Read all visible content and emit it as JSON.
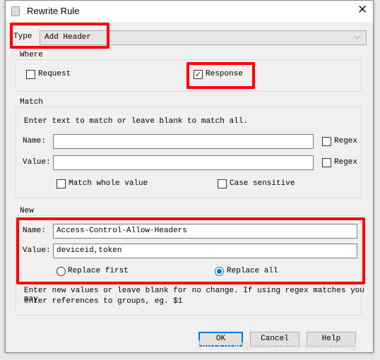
{
  "window": {
    "title": "Rewrite Rule",
    "close_icon": "close-icon"
  },
  "type": {
    "label": "Type",
    "value": "Add Header"
  },
  "where": {
    "legend": "Where",
    "request": {
      "label": "Request",
      "checked": false
    },
    "response": {
      "label": "Response",
      "checked": true
    }
  },
  "match": {
    "legend": "Match",
    "hint": "Enter text to match or leave blank to match all.",
    "name_label": "Name:",
    "name_value": "",
    "value_label": "Value:",
    "value_value": "",
    "regex_label": "Regex",
    "regex2_label": "Regex",
    "whole_label": "Match whole value",
    "case_label": "Case sensitive"
  },
  "new": {
    "legend": "New",
    "name_label": "Name:",
    "name_value": "Access-Control-Allow-Headers",
    "value_label": "Value:",
    "value_value": "deviceid,token",
    "replace_first": "Replace first",
    "replace_all": "Replace all",
    "selected": "Replace all",
    "hint1": "Enter new values or leave blank for no change. If using regex matches you may",
    "hint2": "enter references to groups, eg. $1"
  },
  "buttons": {
    "ok": "OK",
    "cancel": "Cancel",
    "help": "Help"
  },
  "watermark": "https://blog.csdn.net/DearMorning",
  "colors": {
    "highlight": "#ff0000",
    "accent": "#0078d7"
  }
}
